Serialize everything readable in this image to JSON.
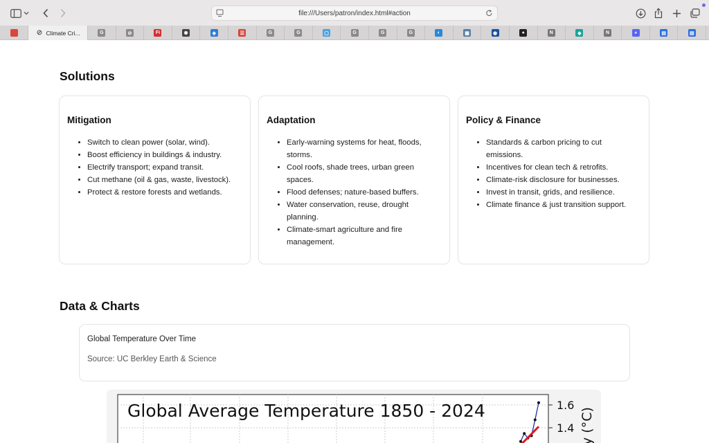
{
  "browser": {
    "url": "file:///Users/patron/index.html#action",
    "active_tab_title": "Climate Cri...",
    "tabs": [
      {
        "icon": "app-icon-red",
        "color": "#d9463b",
        "glyph": ""
      },
      {
        "icon": "compass-icon",
        "color": "#888888",
        "glyph": "⊘",
        "active": true
      },
      {
        "icon": "google-icon",
        "color": "#8a8a8a",
        "glyph": "G"
      },
      {
        "icon": "compass-icon",
        "color": "#8a8a8a",
        "glyph": "⊘"
      },
      {
        "icon": "fi-icon",
        "color": "#d32f2f",
        "glyph": "Fi"
      },
      {
        "icon": "openai-icon",
        "color": "#444444",
        "glyph": "✺"
      },
      {
        "icon": "shield-icon",
        "color": "#2d7dd2",
        "glyph": "◈"
      },
      {
        "icon": "app-icon-red",
        "color": "#d9463b",
        "glyph": "☰"
      },
      {
        "icon": "google-icon",
        "color": "#8a8a8a",
        "glyph": "G"
      },
      {
        "icon": "google-icon",
        "color": "#8a8a8a",
        "glyph": "G"
      },
      {
        "icon": "doc-icon",
        "color": "#4aa3df",
        "glyph": "▢"
      },
      {
        "icon": "google-icon",
        "color": "#8a8a8a",
        "glyph": "G"
      },
      {
        "icon": "google-icon",
        "color": "#8a8a8a",
        "glyph": "G"
      },
      {
        "icon": "google-icon",
        "color": "#8a8a8a",
        "glyph": "G"
      },
      {
        "icon": "toggle-icon",
        "color": "#2b88d8",
        "glyph": "◐"
      },
      {
        "icon": "grid-icon",
        "color": "#5b7fa8",
        "glyph": "▦"
      },
      {
        "icon": "noaa-icon",
        "color": "#1c4f9c",
        "glyph": "◉"
      },
      {
        "icon": "github-icon",
        "color": "#222222",
        "glyph": "●"
      },
      {
        "icon": "notion-icon",
        "color": "#777777",
        "glyph": "N"
      },
      {
        "icon": "diamond-icon",
        "color": "#1aa39a",
        "glyph": "◆"
      },
      {
        "icon": "notion-icon",
        "color": "#777777",
        "glyph": "N"
      },
      {
        "icon": "discord-icon",
        "color": "#5865f2",
        "glyph": "◕"
      },
      {
        "icon": "calendar-icon",
        "color": "#2f6fe0",
        "glyph": "▤"
      },
      {
        "icon": "calendar-icon",
        "color": "#2f6fe0",
        "glyph": "▤"
      }
    ]
  },
  "solutions": {
    "title": "Solutions",
    "cards": [
      {
        "title": "Mitigation",
        "items": [
          "Switch to clean power (solar, wind).",
          "Boost efficiency in buildings & industry.",
          "Electrify transport; expand transit.",
          "Cut methane (oil & gas, waste, livestock).",
          "Protect & restore forests and wetlands."
        ]
      },
      {
        "title": "Adaptation",
        "items": [
          "Early-warning systems for heat, floods, storms.",
          "Cool roofs, shade trees, urban green spaces.",
          "Flood defenses; nature-based buffers.",
          "Water conservation, reuse, drought planning.",
          "Climate-smart agriculture and fire management."
        ]
      },
      {
        "title": "Policy & Finance",
        "items": [
          "Standards & carbon pricing to cut emissions.",
          "Incentives for clean tech & retrofits.",
          "Climate-risk disclosure for businesses.",
          "Invest in transit, grids, and resilience.",
          "Climate finance & just transition support."
        ]
      }
    ]
  },
  "data_charts": {
    "title": "Data & Charts",
    "card_title": "Global Temperature Over Time",
    "card_source": "Source: UC Berkley Earth & Science"
  },
  "chart_data": {
    "type": "line",
    "title": "Global Average Temperature 1850 - 2024",
    "ylabel_partial": "y (°C)",
    "y_tick_labels": [
      "1.6",
      "1.4"
    ],
    "series": [
      {
        "color": "#1f2fa8",
        "x": [
          2019,
          2020,
          2021,
          2022,
          2023,
          2024
        ],
        "y": [
          1.28,
          1.35,
          1.31,
          1.33,
          1.47,
          1.62
        ]
      },
      {
        "color": "#e0181f",
        "x": [
          2019,
          2024
        ],
        "y": [
          1.25,
          1.41
        ]
      }
    ]
  }
}
